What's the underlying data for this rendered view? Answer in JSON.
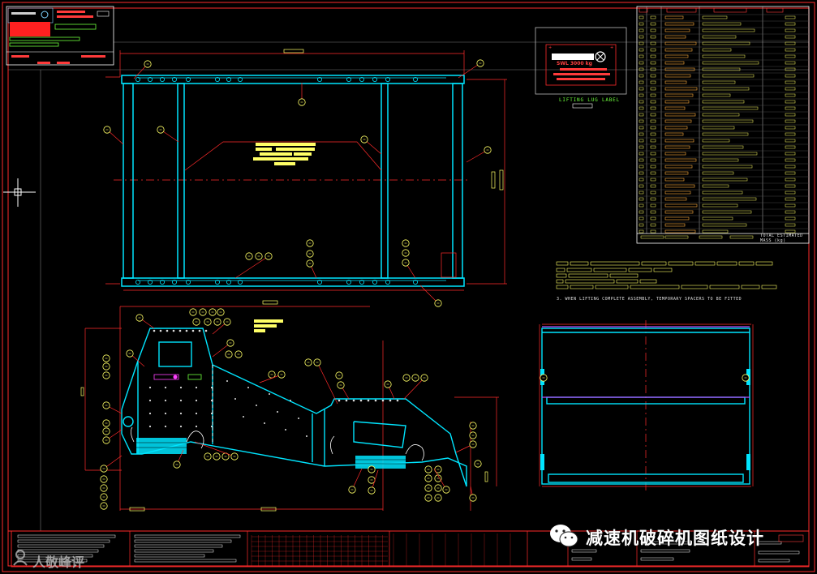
{
  "drawing": {
    "lifting_lug_label": "LIFTING LUG LABEL",
    "plate_weight_text": "SWL 3000 kg",
    "note_text": "3. WHEN LIFTING COMPLETE ASSEMBLY, TEMPORARY SPACERS TO BE FITTED",
    "total_label": "TOTAL ESTIMATED MASS (kg)"
  },
  "watermark": {
    "main_text": "减速机破碎机图纸设计",
    "sub_text": "人敬峰评"
  },
  "colors": {
    "background": "#000000",
    "frame": "#ff2b2b",
    "part_outline": "#00e5ff",
    "dimension": "#ff2b2b",
    "annotation": "#ffff4d",
    "text": "#ffffff",
    "green": "#6eff3c",
    "magenta": "#ff40ff"
  }
}
